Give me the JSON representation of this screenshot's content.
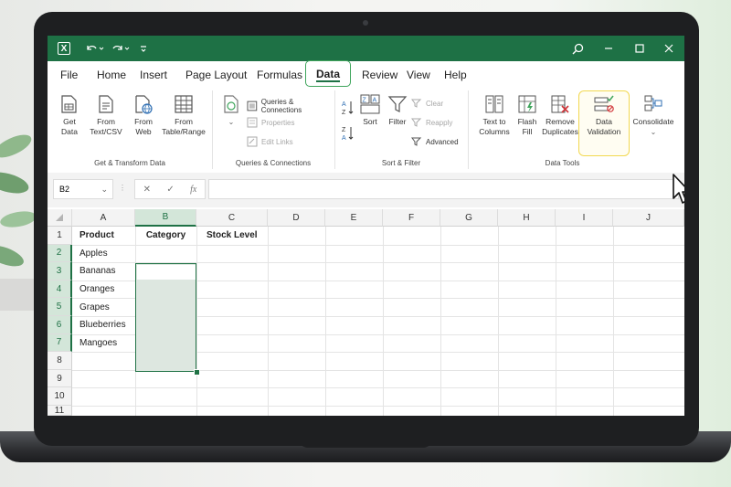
{
  "menu": [
    "File",
    "Home",
    "Insert",
    "Page Layout",
    "Formulas",
    "Data",
    "Review",
    "View",
    "Help"
  ],
  "active_tab": "Data",
  "ribbon": {
    "get_transform": {
      "get_data": "Get Data",
      "from_text": "From Text/CSV",
      "from_web": "From Web",
      "from_table": "From Table/Range",
      "label": "Get & Transform Data"
    },
    "queries": {
      "queries_connections": "Queries & Connections",
      "properties": "Properties",
      "edit_links": "Edit Links",
      "label": "Queries & Connections"
    },
    "sort_filter": {
      "sort": "Sort",
      "filter": "Filter",
      "clear": "Clear",
      "reapply": "Reapply",
      "advanced": "Advanced",
      "label": "Sort & Filter"
    },
    "data_tools": {
      "text_to_columns": "Text to Columns",
      "flash_fill": "Flash Fill",
      "remove_duplicates": "Remove Duplicates",
      "data_validation": "Data Validation",
      "consolidate": "Consolidate",
      "label": "Data Tools"
    }
  },
  "formula_bar": {
    "name_box": "B2",
    "fx": "fx",
    "formula": ""
  },
  "columns": [
    "A",
    "B",
    "C",
    "D",
    "E",
    "F",
    "G",
    "H",
    "I",
    "J"
  ],
  "rows": [
    "1",
    "2",
    "3",
    "4",
    "5",
    "6",
    "7",
    "8",
    "9",
    "10",
    "11"
  ],
  "selected_column": "B",
  "cells": {
    "A1": "Product",
    "B1": "Category",
    "C1": "Stock Level",
    "A2": "Apples",
    "A3": "Bananas",
    "A4": "Oranges",
    "A5": "Grapes",
    "A6": "Blueberries",
    "A7": "Mangoes"
  },
  "colors": {
    "accent": "#1e7145",
    "highlight": "#f2d84f",
    "active_tab_border": "#3fa55c"
  }
}
